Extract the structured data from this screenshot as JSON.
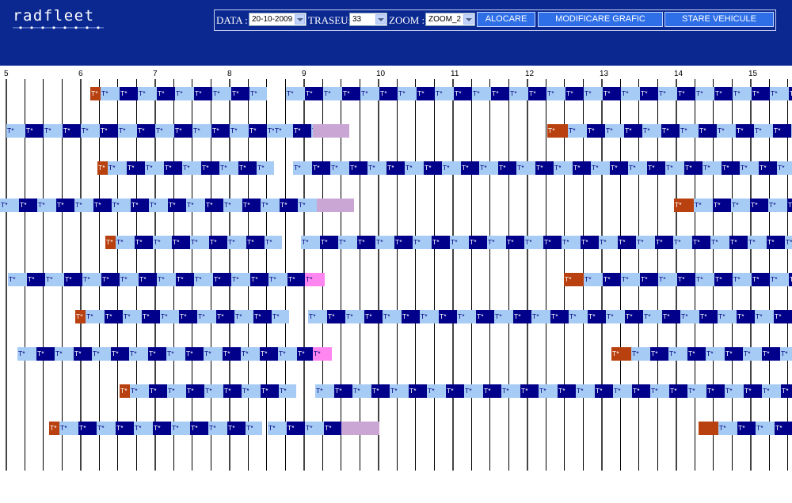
{
  "app": {
    "logo_text": "radfleet"
  },
  "toolbar": {
    "data_label": "DATA :",
    "data_value": "20-10-2009",
    "traseu_label": "TRASEU:",
    "traseu_value": "33",
    "zoom_label": "ZOOM :",
    "zoom_value": "ZOOM_2",
    "alocare_label": "ALOCARE",
    "modificare_label": "MODIFICARE GRAFIC",
    "stare_label": "STARE VEHICULE"
  },
  "timeline": {
    "hour_labels": [
      "5",
      "6",
      "7",
      "8",
      "9",
      "10",
      "11",
      "12",
      "13",
      "14",
      "15"
    ],
    "trip_label": "T*",
    "colors": {
      "dark": "#00008b",
      "light": "#a6cbf5",
      "orange": "#b8410f",
      "pink": "#ff85f0",
      "violet": "#c9a6d3"
    }
  }
}
